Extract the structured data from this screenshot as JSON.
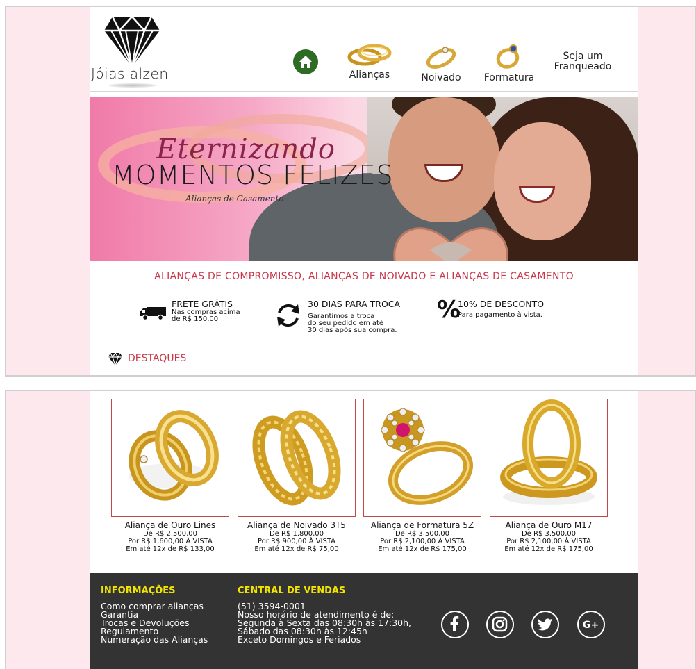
{
  "brand": {
    "name": "Jóias alzen"
  },
  "nav": {
    "home_icon": "home-icon",
    "items": [
      {
        "label": "Alianças",
        "icon": "wedding-rings-icon"
      },
      {
        "label": "Noivado",
        "icon": "engagement-ring-icon"
      },
      {
        "label": "Formatura",
        "icon": "graduation-ring-icon"
      }
    ],
    "franchise_line1": "Seja um",
    "franchise_line2": "Franqueado"
  },
  "banner": {
    "script_text": "Eternizando",
    "title": "MOMENTOS FELIZES",
    "subtitle": "Alianças de Casamento"
  },
  "tagline": "ALIANÇAS DE COMPROMISSO, ALIANÇAS DE NOIVADO E ALIANÇAS DE CASAMENTO",
  "features": [
    {
      "icon": "delivery-truck-icon",
      "title": "FRETE GRÁTIS",
      "desc": [
        "Nas compras acima",
        "de R$ 150,00"
      ]
    },
    {
      "icon": "refresh-arrows-icon",
      "title": "30 DIAS PARA TROCA",
      "desc": [
        "Garantimos a troca",
        "do seu pedido em até",
        "30 dias após sua compra."
      ]
    },
    {
      "icon": "percent-icon",
      "title": "10% DE DESCONTO",
      "desc": [
        "Para pagamento à vista."
      ]
    }
  ],
  "destaques": {
    "label": "DESTAQUES",
    "icon": "diamond-icon"
  },
  "products": [
    {
      "name": "Aliança de Ouro Lines",
      "from": "De R$ 2.500,00",
      "price": "Por R$ 1,600,00 À VISTA",
      "installments": "Em até 12x de R$ 133,00"
    },
    {
      "name": "Aliança de Noivado 3T5",
      "from": "De R$ 1.800,00",
      "price": "Por R$ 900,00 À VISTA",
      "installments": "Em até 12x de R$ 75,00"
    },
    {
      "name": "Aliança de Formatura 5Z",
      "from": "De R$ 3.500,00",
      "price": "Por R$ 2,100,00 À VISTA",
      "installments": "Em até 12x de R$ 175,00"
    },
    {
      "name": "Aliança de Ouro M17",
      "from": "De R$ 3.500,00",
      "price": "Por R$ 2,100,00 À VISTA",
      "installments": "Em até 12x de R$ 175,00"
    }
  ],
  "footer": {
    "info_title": "INFORMAÇÕES",
    "info_links": [
      "Como comprar alianças",
      "Garantia",
      "Trocas e Devoluções",
      "Regulamento",
      "Numeração das Alianças"
    ],
    "central_title": "CENTRAL DE VENDAS",
    "central_lines": [
      "(51) 3594-0001",
      "Nosso horário de atendimento é de:",
      "Segunda à Sexta das 08:30h às 17:30h,",
      "Sábado das 08:30h às 12:45h",
      "Exceto Domingos e Feriados"
    ],
    "social": [
      "facebook-icon",
      "instagram-icon",
      "twitter-icon",
      "google-plus-icon"
    ]
  },
  "colors": {
    "accent_red": "#c8374a",
    "footer_bg": "#333333",
    "footer_title": "#f2e400",
    "home_green": "#2e6b24",
    "page_pink": "#fde8ee"
  }
}
